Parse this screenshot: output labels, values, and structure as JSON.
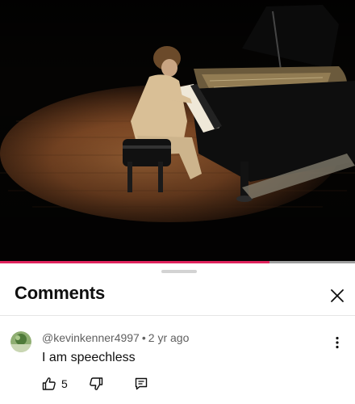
{
  "video": {
    "progress_fraction": 0.76
  },
  "comments_panel": {
    "title": "Comments",
    "close_icon": "close-icon",
    "comment": {
      "author": "@kevinkenner4997",
      "separator": "•",
      "age": "2 yr ago",
      "text": "I am speechless",
      "like_count": "5",
      "icons": [
        "thumbs-up-icon",
        "thumbs-down-icon",
        "reply-icon",
        "more-vertical-icon"
      ]
    }
  },
  "colors": {
    "progress": "#e0245e",
    "text_primary": "#0f0f0f",
    "text_secondary": "#606060"
  }
}
